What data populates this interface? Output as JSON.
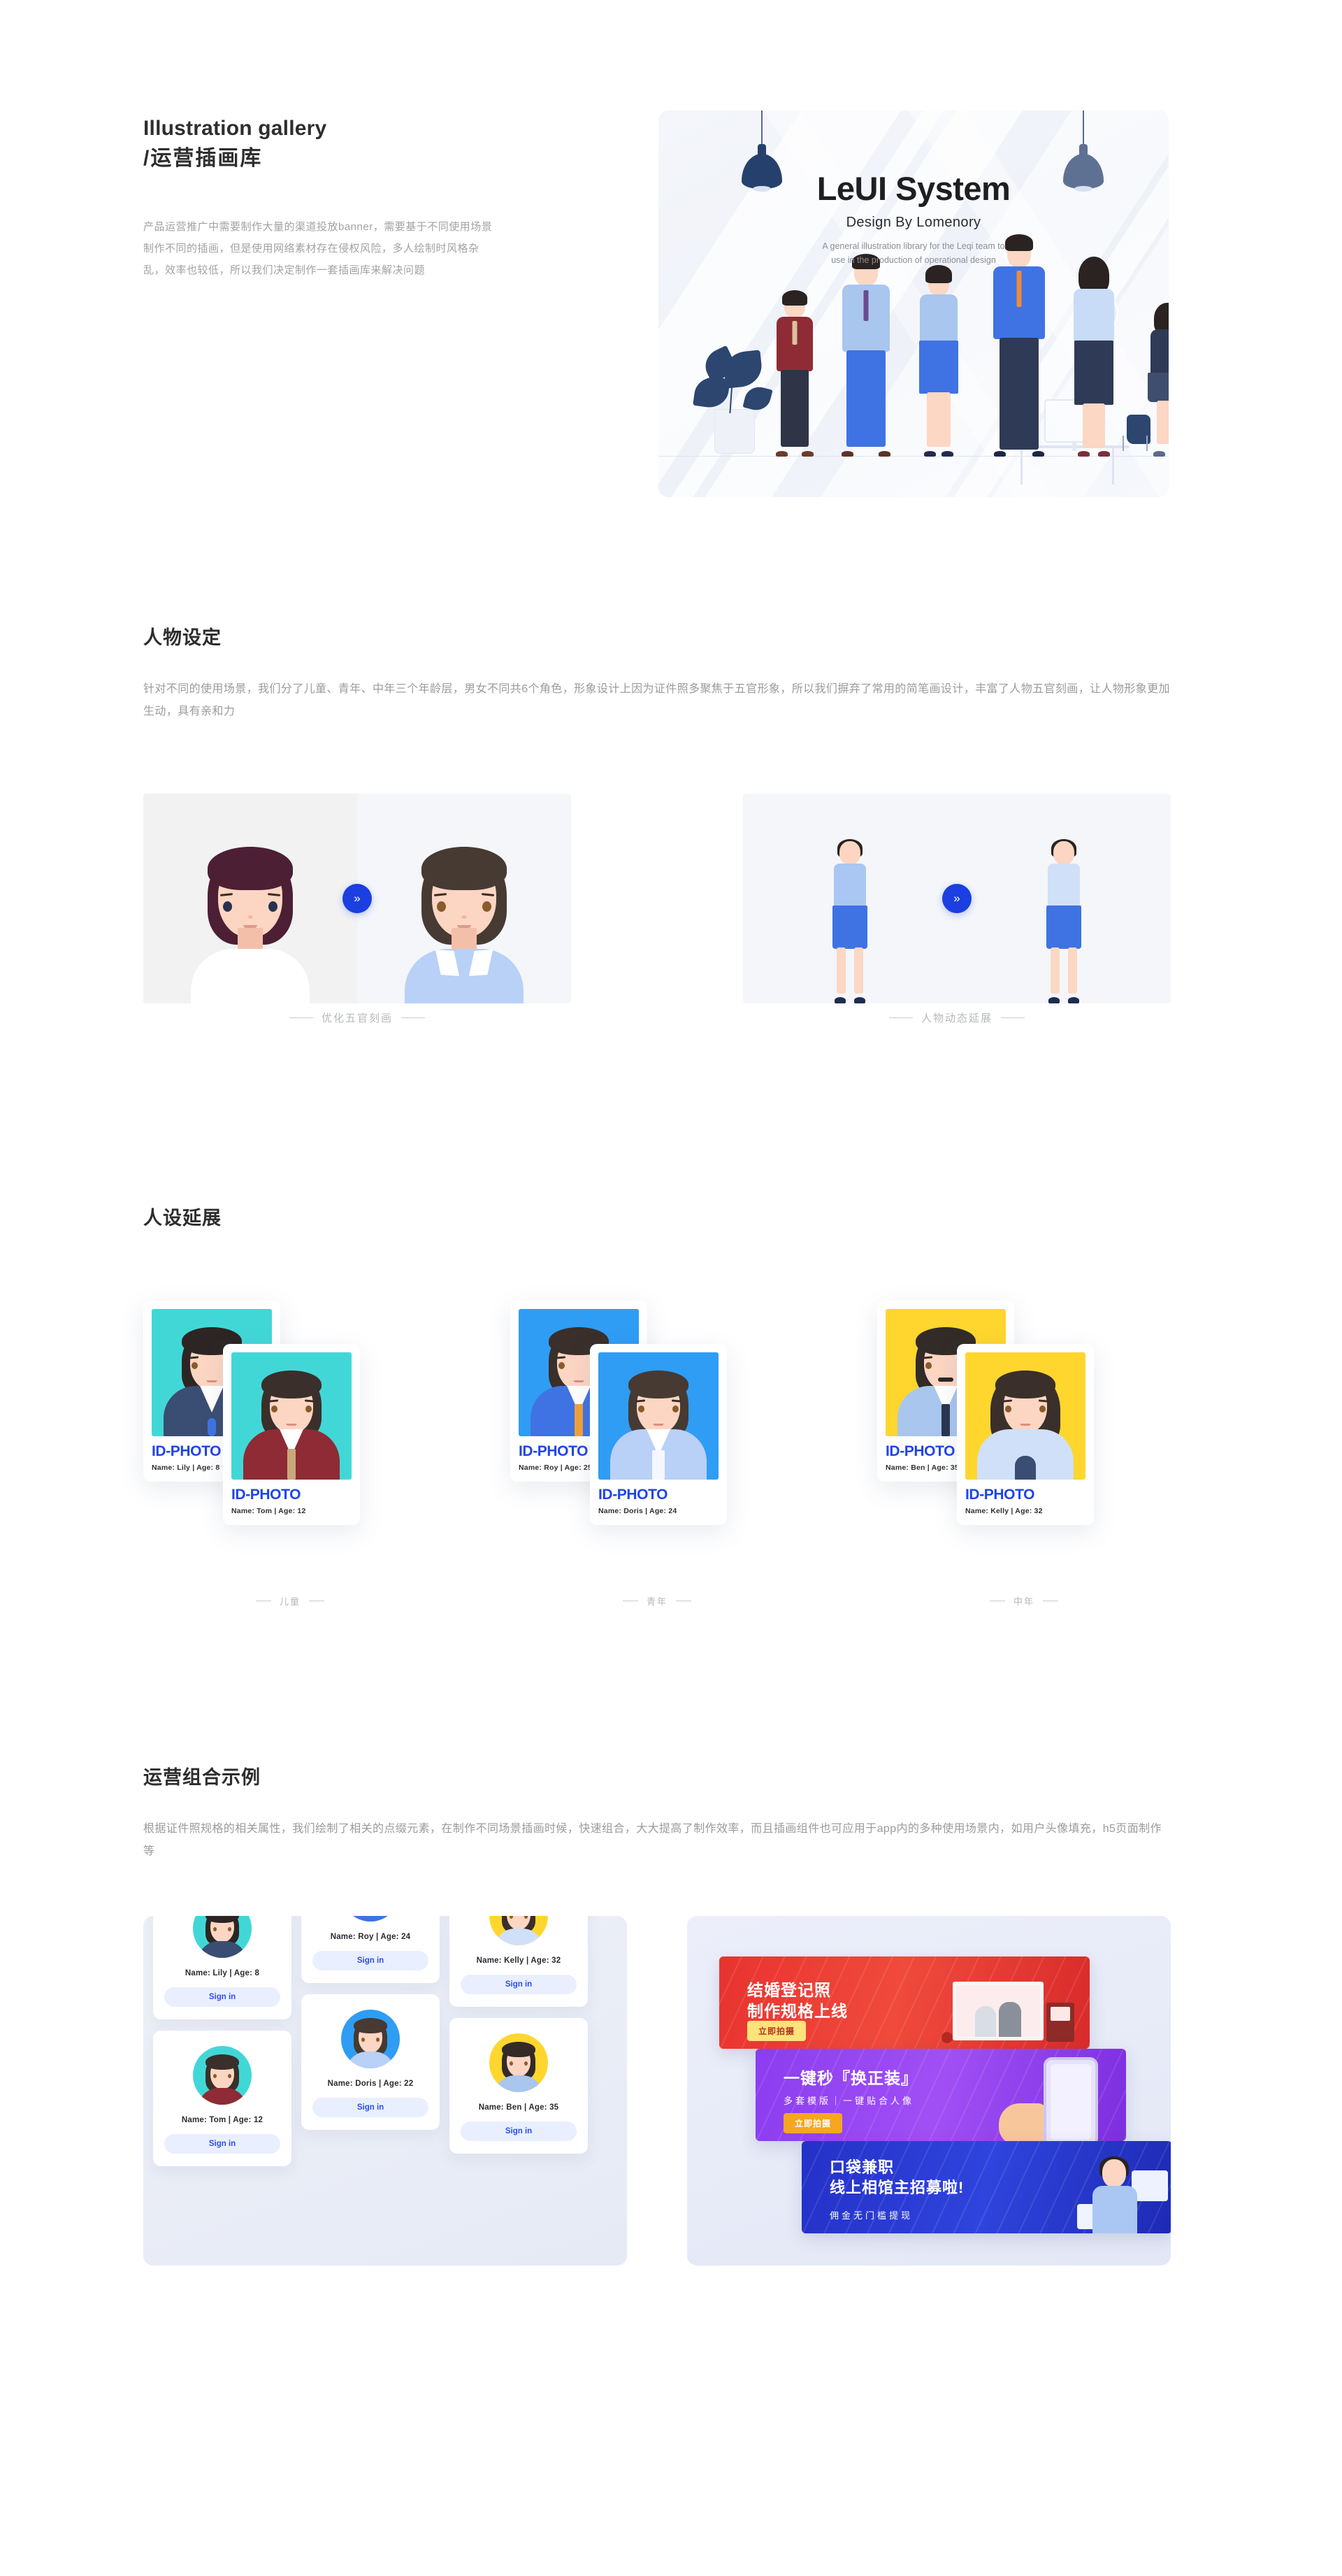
{
  "hero": {
    "title_en": "Illustration gallery",
    "title_cn": "/运营插画库",
    "paragraph": "产品运营推广中需要制作大量的渠道投放banner，需要基于不同使用场景制作不同的插画，但是使用网络素材存在侵权风险，多人绘制时风格杂乱，效率也较低，所以我们决定制作一套插画库来解决问题",
    "card": {
      "brand": "LeUI System",
      "by": "Design By Lomenory",
      "sub_line1": "A general illustration library for the Leqi team to",
      "sub_line2": "use in the production of operational design"
    }
  },
  "section_characters": {
    "title": "人物设定",
    "desc": "针对不同的使用场景，我们分了儿童、青年、中年三个年龄层，男女不同共6个角色，形象设计上因为证件照多聚焦于五官形象，所以我们摒弃了常用的简笔画设计，丰富了人物五官刻画，让人物形象更加生动，具有亲和力",
    "compare_left_caption": "优化五官刻画",
    "compare_right_caption": "人物动态延展",
    "arrow_icon": "»"
  },
  "section_extension": {
    "title": "人设延展",
    "groups": [
      {
        "caption": "儿童",
        "cards": [
          {
            "title": "ID-PHOTO",
            "meta": "Name: Lily  |  Age: 8",
            "bg": "#42d7d7"
          },
          {
            "title": "ID-PHOTO",
            "meta": "Name: Tom  |  Age: 12",
            "bg": "#42d7d7"
          }
        ]
      },
      {
        "caption": "青年",
        "cards": [
          {
            "title": "ID-PHOTO",
            "meta": "Name: Roy  |  Age: 25",
            "bg": "#2f9df4"
          },
          {
            "title": "ID-PHOTO",
            "meta": "Name: Doris  |  Age: 24",
            "bg": "#2f9df4"
          }
        ]
      },
      {
        "caption": "中年",
        "cards": [
          {
            "title": "ID-PHOTO",
            "meta": "Name: Ben  |  Age: 35",
            "bg": "#ffd62e"
          },
          {
            "title": "ID-PHOTO",
            "meta": "Name: Kelly  |  Age: 32",
            "bg": "#ffd62e"
          }
        ]
      }
    ]
  },
  "section_examples": {
    "title": "运营组合示例",
    "desc": "根据证件照规格的相关属性，我们绘制了相关的点缀元素，在制作不同场景插画时候，快速组合，大大提高了制作效率，而且插画组件也可应用于app内的多种使用场景内，如用户头像填充，h5页面制作等",
    "avatar_cards": [
      {
        "name": "Name: Lily  |  Age: 8",
        "button": "Sign in",
        "bg": "#42d7d7"
      },
      {
        "name": "Name: Tom  |  Age: 12",
        "button": "Sign in",
        "bg": "#42d7d7"
      },
      {
        "name": "Name: Roy  |  Age: 24",
        "button": "Sign in",
        "bg": "#2f9df4"
      },
      {
        "name": "Name: Doris  |  Age: 22",
        "button": "Sign in",
        "bg": "#2f9df4"
      },
      {
        "name": "Name: Kelly  |  Age: 32",
        "button": "Sign in",
        "bg": "#ffd62e"
      },
      {
        "name": "Name: Ben  |  Age: 35",
        "button": "Sign in",
        "bg": "#ffd62e"
      }
    ],
    "banners": [
      {
        "line1": "结婚登记照",
        "line2": "制作规格上线",
        "subtitle": "",
        "button": "立即拍摄",
        "color": "#e8332f",
        "button_color": "#ffe27a"
      },
      {
        "line1": "一键秒『换正装』",
        "line2": "",
        "subtitle": "多套模版｜一键贴合人像",
        "button": "立即拍摄",
        "color": "#8b3df0",
        "button_color": "#f5a623"
      },
      {
        "line1": "口袋兼职",
        "line2": "线上相馆主招募啦!",
        "subtitle": "佣金无门槛提现",
        "button": "",
        "color": "#2431c8",
        "button_color": ""
      }
    ]
  },
  "colors": {
    "accent_blue": "#1b3fe0",
    "id_title_blue": "#1e45e8",
    "text_dark": "#2d2d2d",
    "text_muted": "#9b9b9b"
  }
}
